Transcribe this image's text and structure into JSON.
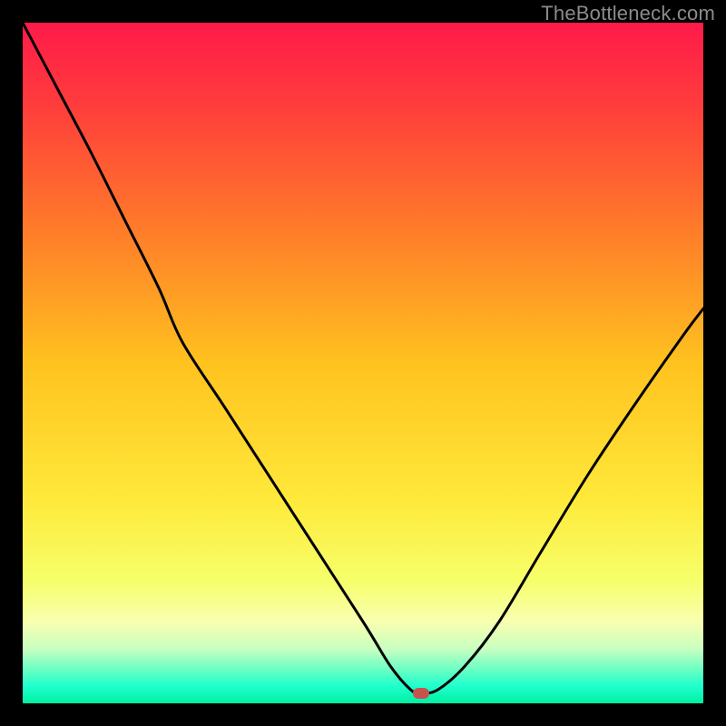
{
  "watermark": "TheBottleneck.com",
  "colors": {
    "background": "#000000",
    "curve": "#000000",
    "marker": "#c8524d",
    "watermark_text": "#8b8b8b",
    "gradient_stops": [
      {
        "offset": 0.0,
        "color": "#ff1a4a"
      },
      {
        "offset": 0.12,
        "color": "#ff3c3c"
      },
      {
        "offset": 0.3,
        "color": "#ff7a2a"
      },
      {
        "offset": 0.5,
        "color": "#ffc21f"
      },
      {
        "offset": 0.7,
        "color": "#ffe93a"
      },
      {
        "offset": 0.82,
        "color": "#f6ff6a"
      },
      {
        "offset": 0.88,
        "color": "#f9ffb0"
      },
      {
        "offset": 0.92,
        "color": "#c8ffc0"
      },
      {
        "offset": 0.955,
        "color": "#5cffc4"
      },
      {
        "offset": 0.975,
        "color": "#1fffcf"
      },
      {
        "offset": 1.0,
        "color": "#00f0a0"
      }
    ]
  },
  "chart_data": {
    "type": "line",
    "title": "",
    "xlabel": "",
    "ylabel": "",
    "xlim": [
      0,
      100
    ],
    "ylim": [
      0,
      100
    ],
    "grid": false,
    "legend": false,
    "series": [
      {
        "name": "bottleneck-curve",
        "x": [
          0,
          5,
          10,
          15,
          20,
          23.5,
          30,
          40,
          50,
          54,
          57,
          58.5,
          61,
          65,
          70,
          76,
          83,
          90,
          97,
          100
        ],
        "y": [
          100,
          90.5,
          81,
          71,
          61,
          53,
          43,
          27.5,
          12,
          5.5,
          2,
          1.5,
          2,
          5.5,
          12,
          22,
          33.5,
          44,
          54,
          58
        ]
      }
    ],
    "annotations": [
      {
        "name": "minimum-marker",
        "x": 58.5,
        "y": 1.5
      }
    ]
  }
}
